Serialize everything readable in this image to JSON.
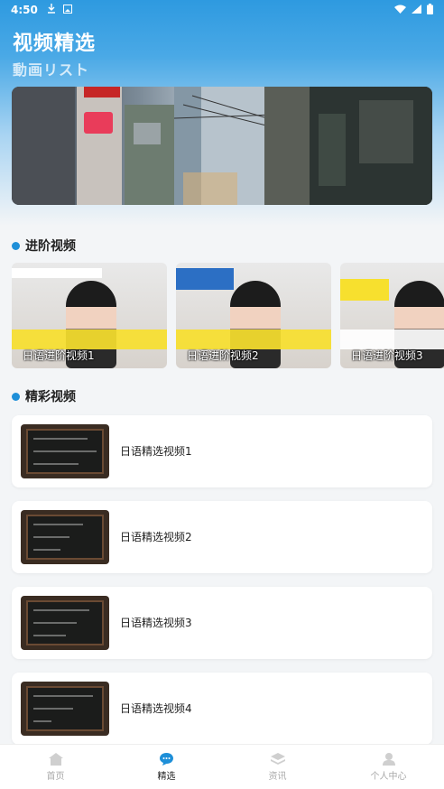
{
  "status_bar": {
    "time": "4:50",
    "icons": [
      "download-icon",
      "image-icon",
      "wifi-icon",
      "signal-icon",
      "battery-icon"
    ]
  },
  "header": {
    "title": "视频精选",
    "subtitle": "動画リスト"
  },
  "sections": {
    "advanced": {
      "title": "进阶视频",
      "items": [
        {
          "label": "日语进阶视频1"
        },
        {
          "label": "日语进阶视频2"
        },
        {
          "label": "日语进阶视频3"
        }
      ]
    },
    "featured": {
      "title": "精彩视频",
      "items": [
        {
          "title": "日语精选视频1"
        },
        {
          "title": "日语精选视频2"
        },
        {
          "title": "日语精选视频3"
        },
        {
          "title": "日语精选视频4"
        }
      ]
    }
  },
  "tabbar": {
    "active": "精选",
    "tabs": [
      {
        "label": "首页",
        "icon": "home-icon"
      },
      {
        "label": "精选",
        "icon": "chat-icon"
      },
      {
        "label": "资讯",
        "icon": "layers-icon"
      },
      {
        "label": "个人中心",
        "icon": "user-icon"
      }
    ]
  },
  "colors": {
    "accent": "#1e8fd8",
    "header_gradient_top": "#2e9ae0"
  }
}
